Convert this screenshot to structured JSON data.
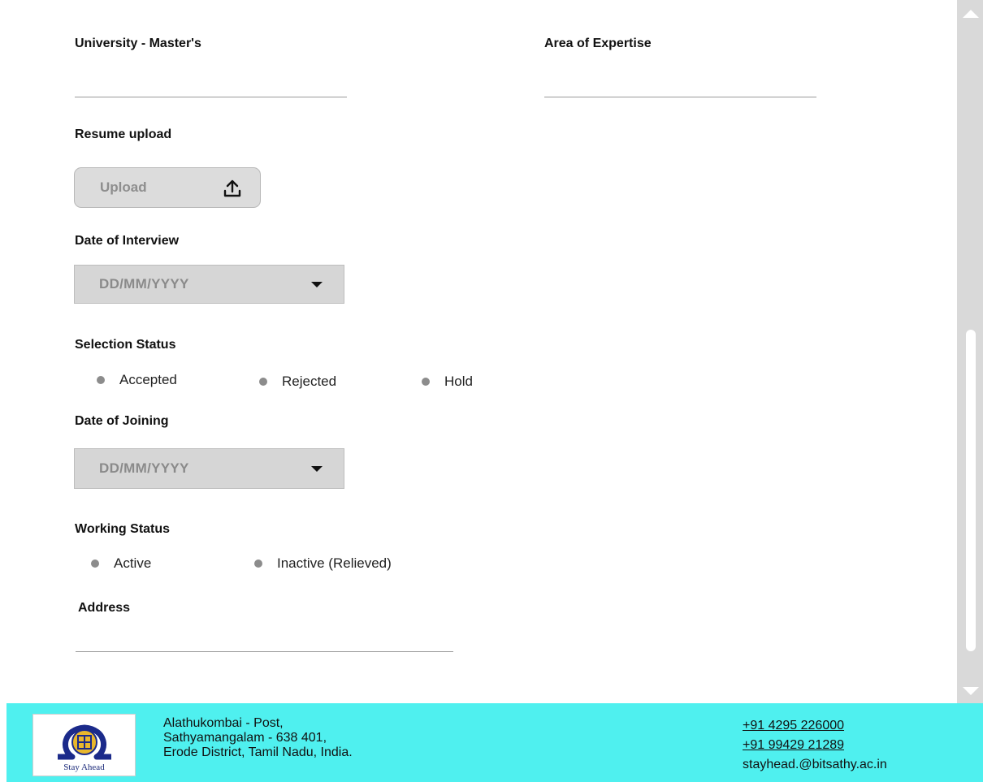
{
  "form": {
    "university_masters_label": "University - Master's",
    "area_of_expertise_label": "Area of Expertise",
    "resume_upload_label": "Resume upload",
    "upload_button_label": "Upload",
    "date_of_interview_label": "Date of Interview",
    "date_of_interview_placeholder": "DD/MM/YYYY",
    "selection_status_label": "Selection Status",
    "selection_options": [
      "Accepted",
      "Rejected",
      "Hold"
    ],
    "date_of_joining_label": "Date of Joining",
    "date_of_joining_placeholder": "DD/MM/YYYY",
    "working_status_label": "Working Status",
    "working_options": [
      "Active",
      "Inactive (Relieved)"
    ],
    "address_label": "Address"
  },
  "footer": {
    "logo_tagline": "Stay Ahead",
    "address_lines": [
      "Alathukombai - Post,",
      "Sathyamangalam - 638 401,",
      "Erode District, Tamil Nadu, India."
    ],
    "phone_1": "+91 4295 226000",
    "phone_2": "+91 99429 21289",
    "email": "stayhead.@bitsathy.ac.in"
  },
  "icons": {
    "upload": "upload-icon",
    "dropdown": "caret-down-icon",
    "radio": "radio-dot-icon",
    "scroll_up": "arrow-up-icon",
    "scroll_down": "arrow-down-icon"
  },
  "colors": {
    "footer_bg": "#4ff0ef",
    "input_bg": "#d6d6d6",
    "scrollbar": "#d9d9d9"
  }
}
